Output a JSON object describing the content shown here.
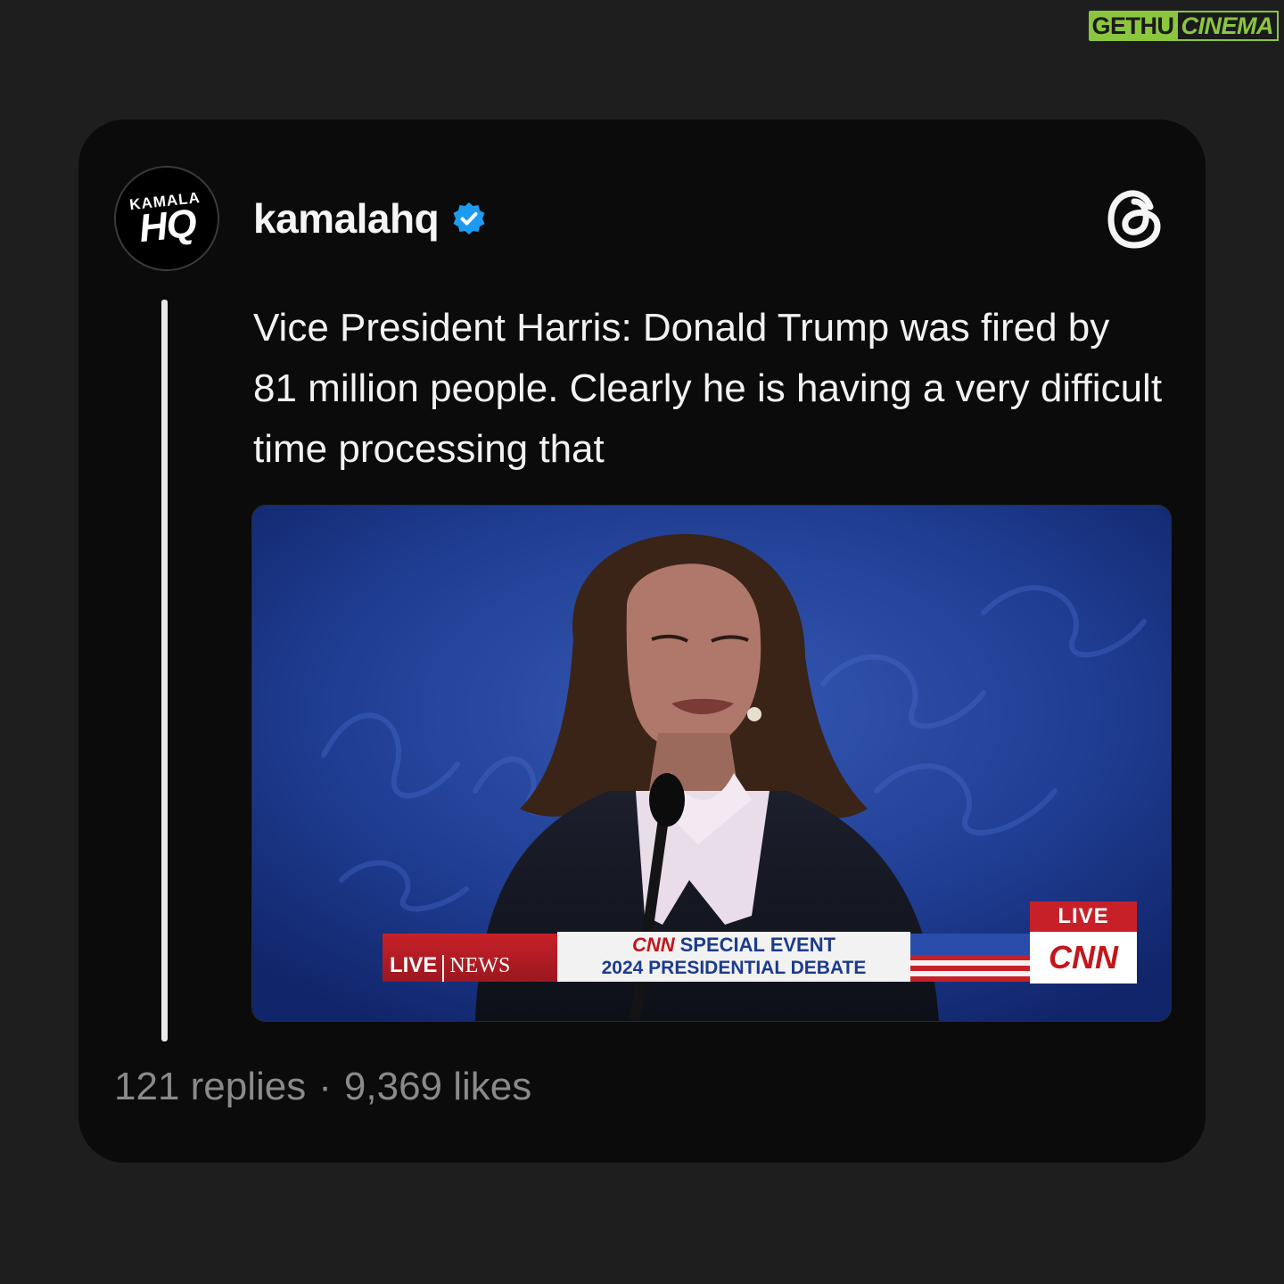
{
  "watermark": {
    "part1": "GETHU",
    "part2": "CINEMA"
  },
  "post": {
    "avatar": {
      "top": "KAMALA",
      "bottom": "HQ"
    },
    "username": "kamalahq",
    "text": "Vice President Harris: Donald Trump was fired by 81 million people. Clearly he is having a very difficult time processing that",
    "media": {
      "chyron_live": "LIVE",
      "chyron_network": "NEWS",
      "chyron_brand": "CNN",
      "chyron_line1": "SPECIAL EVENT",
      "chyron_line2": "2024 PRESIDENTIAL DEBATE",
      "cnn_live": "LIVE",
      "cnn_logo": "CNN"
    },
    "replies": "121 replies",
    "separator": "·",
    "likes": "9,369 likes"
  },
  "colors": {
    "verified": "#1d9bf0",
    "background": "#1e1e1e",
    "card": "#0b0b0b",
    "stats": "#8a8a8a"
  },
  "icons": {
    "verified": "verified-badge-icon",
    "threads": "threads-logo-icon"
  }
}
